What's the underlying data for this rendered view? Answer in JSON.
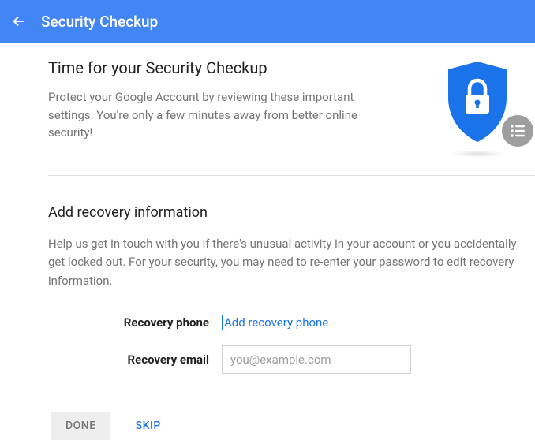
{
  "header": {
    "title": "Security Checkup"
  },
  "intro": {
    "title": "Time for your Security Checkup",
    "description": "Protect your Google Account by reviewing these important settings. You're only a few minutes away from better online security!"
  },
  "recovery": {
    "title": "Add recovery information",
    "description": "Help us get in touch with you if there's unusual activity in your account or you accidentally get locked out. For your security, you may need to re-enter your password to edit recovery information.",
    "phone_label": "Recovery phone",
    "phone_link": "Add recovery phone",
    "email_label": "Recovery email",
    "email_placeholder": "you@example.com",
    "email_value": ""
  },
  "buttons": {
    "done": "DONE",
    "skip": "SKIP"
  },
  "colors": {
    "primary": "#4285f4",
    "link": "#1a73e8",
    "grey": "#9e9e9e"
  }
}
